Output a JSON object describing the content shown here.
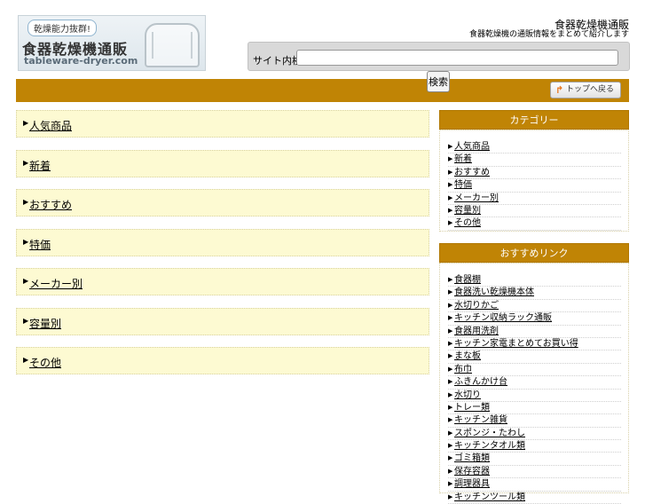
{
  "header": {
    "logo": {
      "tagline": "乾燥能力抜群!",
      "name_jp": "食器乾燥機通販",
      "name_en": "tableware-dryer.com"
    },
    "site_title": "食器乾燥機通販",
    "site_description": "食器乾燥機の通販情報をまとめて紹介します"
  },
  "search": {
    "label": "サイト内検索",
    "value": "",
    "placeholder": "",
    "button_label": "検索"
  },
  "nav": {
    "top_button_label": "トップへ戻る"
  },
  "main": {
    "categories": [
      {
        "label": "人気商品"
      },
      {
        "label": "新着"
      },
      {
        "label": "おすすめ"
      },
      {
        "label": "特価"
      },
      {
        "label": "メーカー別"
      },
      {
        "label": "容量別"
      },
      {
        "label": "その他"
      }
    ]
  },
  "sidebar": {
    "category_title": "カテゴリー",
    "category_items": [
      {
        "label": "人気商品"
      },
      {
        "label": "新着"
      },
      {
        "label": "おすすめ"
      },
      {
        "label": "特価"
      },
      {
        "label": "メーカー別"
      },
      {
        "label": "容量別"
      },
      {
        "label": "その他"
      }
    ],
    "links_title": "おすすめリンク",
    "link_items": [
      {
        "label": "食器棚"
      },
      {
        "label": "食器洗い乾燥機本体"
      },
      {
        "label": "水切りかご"
      },
      {
        "label": "キッチン収納ラック通販"
      },
      {
        "label": "食器用洗剤"
      },
      {
        "label": "キッチン家電まとめてお買い得"
      },
      {
        "label": "まな板"
      },
      {
        "label": "布巾"
      },
      {
        "label": "ふきんかけ台"
      },
      {
        "label": "水切り"
      },
      {
        "label": "トレー類"
      },
      {
        "label": "キッチン雑貨"
      },
      {
        "label": "スポンジ・たわし"
      },
      {
        "label": "キッチンタオル類"
      },
      {
        "label": "ゴミ箱類"
      },
      {
        "label": "保存容器"
      },
      {
        "label": "調理器具"
      },
      {
        "label": "キッチンツール類"
      }
    ]
  },
  "colors": {
    "accent": "#c08405",
    "category_bg": "#fdfad2",
    "search_bar_bg": "#d9d9d9"
  },
  "icons": {
    "bullet": "triangle-right-icon",
    "top": "return-arrow-icon"
  }
}
